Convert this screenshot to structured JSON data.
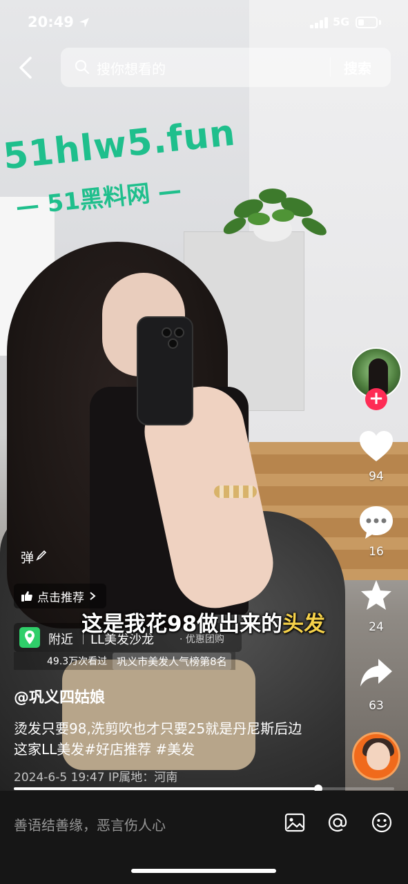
{
  "status_bar": {
    "time": "20:49",
    "network": "5G",
    "battery_level": 0.35
  },
  "search": {
    "placeholder": "搜你想看的",
    "button_label": "搜索"
  },
  "watermark": {
    "line1": "51hlw5.fun",
    "line2": "— 51黑料网 —"
  },
  "right_rail": {
    "likes": "94",
    "comments": "16",
    "favorites": "24",
    "shares": "63"
  },
  "overlay": {
    "danmu_label": "弹",
    "recommend_label": "点击推荐",
    "caption_main": "这是我花98做出来的",
    "caption_highlight": "头发",
    "poi": {
      "nearby": "附近",
      "shop_name": "LL美发沙龙",
      "tag": "· 优惠团购",
      "views": "49.3万次看过",
      "rank": "巩义市美发人气榜第8名"
    },
    "author": "@巩义四姑娘",
    "description": "烫发只要98,洗剪吹也才只要25就是丹尼斯后边这家LL美发#好店推荐 #美发",
    "meta": "2024-6-5 19:47  IP属地：河南"
  },
  "progress": {
    "played_fraction": 0.8
  },
  "comment_bar": {
    "placeholder": "善语结善缘，恶言伤人心",
    "icons": [
      "image-icon",
      "at-icon",
      "emoji-icon"
    ]
  },
  "colors": {
    "follow": "#fe2c55",
    "watermark": "#1fbf8c",
    "caption_highlight": "#f6d24a",
    "poi_pin": "#2fcf6a"
  }
}
